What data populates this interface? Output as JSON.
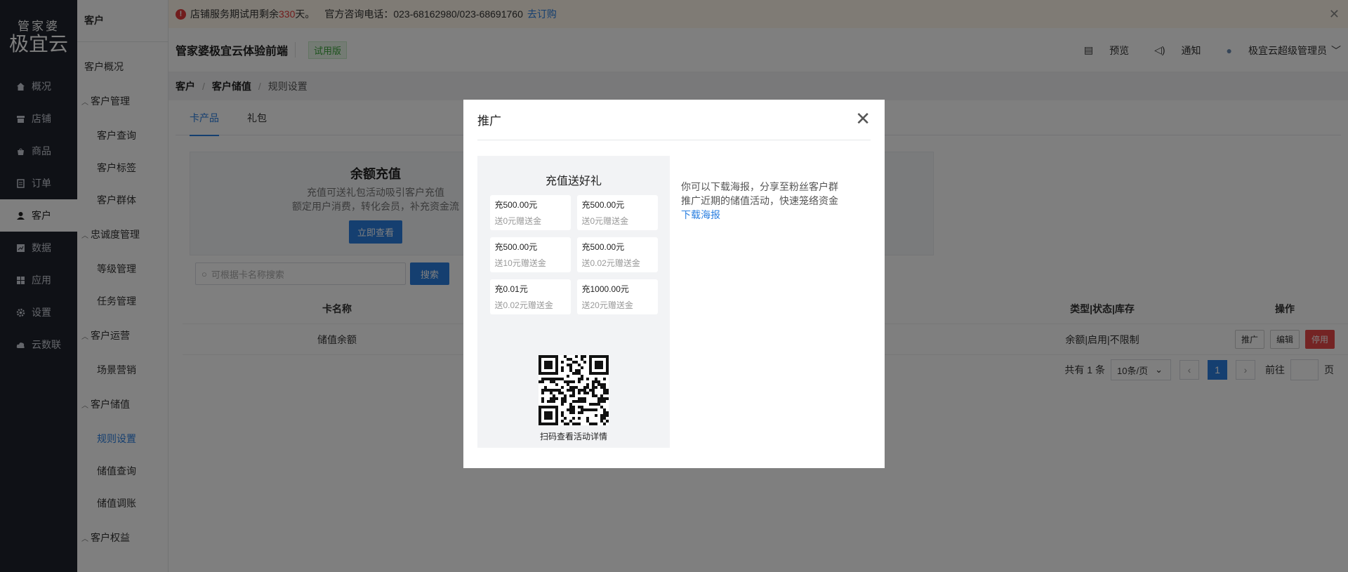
{
  "sidebar": {
    "logo_top": "管家婆",
    "logo_bottom": "极宜云",
    "items": [
      {
        "label": "概况",
        "icon": "home-icon"
      },
      {
        "label": "店铺",
        "icon": "store-icon"
      },
      {
        "label": "商品",
        "icon": "product-icon"
      },
      {
        "label": "订单",
        "icon": "order-icon"
      },
      {
        "label": "客户",
        "icon": "user-icon",
        "active": true
      },
      {
        "label": "数据",
        "icon": "chart-icon"
      },
      {
        "label": "应用",
        "icon": "apps-icon"
      },
      {
        "label": "设置",
        "icon": "gear-icon"
      },
      {
        "label": "云数联",
        "icon": "cloud-icon"
      }
    ]
  },
  "submenu": {
    "header": "客户",
    "overview": "客户概况",
    "g1": "客户管理",
    "g1_items": [
      "客户查询",
      "客户标签",
      "客户群体"
    ],
    "g2": "忠诚度管理",
    "g2_items": [
      "等级管理",
      "任务管理"
    ],
    "g3": "客户运营",
    "g3_items": [
      "场景营销"
    ],
    "g4": "客户储值",
    "g4_items": [
      "规则设置",
      "储值查询",
      "储值调账"
    ],
    "g5": "客户权益"
  },
  "notice": {
    "prefix": "店铺服务期试用剩余",
    "days": "330",
    "suffix": "天。",
    "phone": "官方咨询电话：023-68162980/023-68691760",
    "link": "去订购",
    "close": "✕"
  },
  "topbar": {
    "store_name": "管家婆极宜云体验前端",
    "badge": "试用版",
    "preview": "预览",
    "notify": "通知",
    "user": "极宜云超级管理员"
  },
  "breadcrumb": {
    "c1": "客户",
    "c2": "客户储值",
    "c3": "规则设置"
  },
  "tabs": [
    "卡产品",
    "礼包"
  ],
  "promo": {
    "title": "余额充值",
    "line1": "充值可送礼包活动吸引客户充值",
    "line2": "额定用户消费，转化会员，补充资金流",
    "button": "立即查看"
  },
  "search": {
    "placeholder": "可根据卡名称搜索",
    "button": "搜索"
  },
  "table": {
    "headers": {
      "name": "卡名称",
      "type": "类型|状态|库存",
      "ops": "操作"
    },
    "rows": [
      {
        "name": "储值余额",
        "type": "余额|启用|不限制",
        "op1": "推广",
        "op2": "编辑",
        "op3": "停用"
      }
    ]
  },
  "pager": {
    "total": "共有 1 条",
    "size": "10条/页",
    "page": "1",
    "goto": "前往",
    "unit": "页"
  },
  "modal": {
    "title": "推广",
    "poster_title": "充值送好礼",
    "cells": [
      {
        "amount": "充500.00元",
        "gift": "送0元赠送金"
      },
      {
        "amount": "充500.00元",
        "gift": "送0元赠送金"
      },
      {
        "amount": "充500.00元",
        "gift": "送10元赠送金"
      },
      {
        "amount": "充500.00元",
        "gift": "送0.02元赠送金"
      },
      {
        "amount": "充0.01元",
        "gift": "送0.02元赠送金"
      },
      {
        "amount": "充1000.00元",
        "gift": "送20元赠送金"
      }
    ],
    "qr_caption": "扫码查看活动详情",
    "desc1": "你可以下载海报，分享至粉丝客户群",
    "desc2": "推广近期的储值活动，快速笼络资金",
    "download": "下载海报"
  }
}
